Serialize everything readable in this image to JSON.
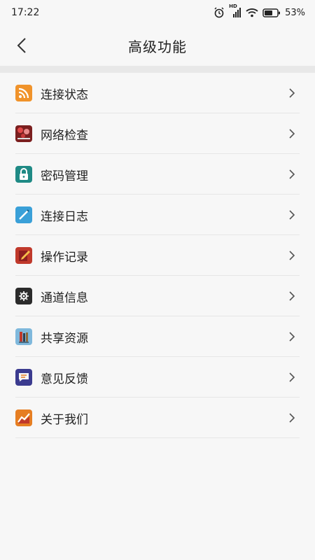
{
  "status_bar": {
    "time": "17:22",
    "battery": "53%",
    "network": "HD"
  },
  "header": {
    "title": "高级功能"
  },
  "menu": {
    "items": [
      {
        "label": "连接状态",
        "icon": "rss-icon",
        "color": "#f0932b"
      },
      {
        "label": "网络检查",
        "icon": "network-check-icon",
        "color": "#7b1f1f"
      },
      {
        "label": "密码管理",
        "icon": "lock-icon",
        "color": "#1f8a85"
      },
      {
        "label": "连接日志",
        "icon": "pen-icon",
        "color": "#3aa0d8"
      },
      {
        "label": "操作记录",
        "icon": "pencil-book-icon",
        "color": "#c0392b"
      },
      {
        "label": "通道信息",
        "icon": "gear-icon",
        "color": "#2b2b2b"
      },
      {
        "label": "共享资源",
        "icon": "books-icon",
        "color": "#7fb8dc"
      },
      {
        "label": "意见反馈",
        "icon": "chat-icon",
        "color": "#3b3b8f"
      },
      {
        "label": "关于我们",
        "icon": "chart-icon",
        "color": "#e67e22"
      }
    ]
  }
}
